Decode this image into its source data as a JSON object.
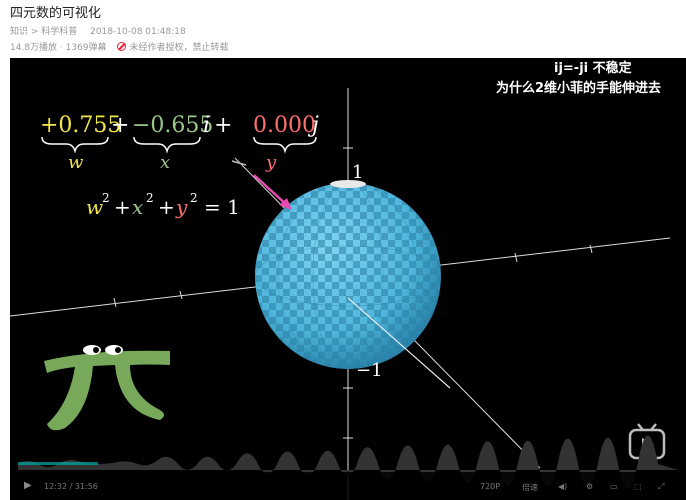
{
  "header": {
    "title": "四元数的可视化",
    "breadcrumb": "知识 > 科学科普",
    "datetime": "2018-10-08 01:48:18",
    "stats": "14.8万播放 · 1369弹幕",
    "warning": "未经作者授权，禁止转载"
  },
  "video": {
    "subtitle_line1": "ij=-ji 不稳定",
    "subtitle_line2": "为什么2维小菲的手能伸进去",
    "quaternion": {
      "w": "+0.755",
      "x": "−0.655",
      "y": "0.000",
      "w_label": "w",
      "x_label": "x",
      "y_label": "y",
      "i_sym": "i",
      "j_sym": "j",
      "plus": "+"
    },
    "equation": {
      "w": "w",
      "x": "x",
      "y": "y",
      "eq": "= 1",
      "exp": "2"
    },
    "axis_top": "1",
    "axis_bottom": "−1",
    "colors": {
      "w": "#f3e84b",
      "x": "#9bc78a",
      "y": "#ff6f6f",
      "sphere": "#4fb6dc",
      "pi": "#78a95a",
      "arrow": "#e84bb0"
    }
  },
  "controls": {
    "time": "12:32 / 31:56",
    "quality": "720P",
    "speed": "倍速"
  }
}
